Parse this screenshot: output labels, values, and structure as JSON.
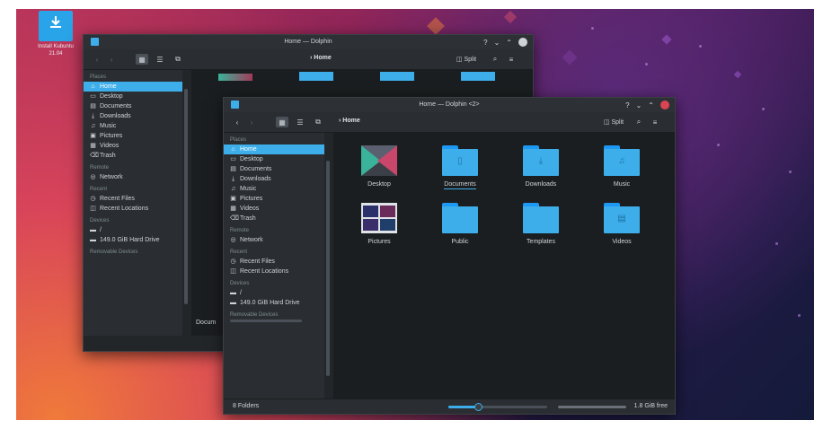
{
  "desktop": {
    "icon_label_top": "Install Kubuntu",
    "icon_label_bottom": "21.04",
    "icon_name": "download-icon"
  },
  "back_window": {
    "title": "Home — Dolphin",
    "breadcrumb": "Home",
    "split_label": "Split",
    "sections": {
      "places": "Places",
      "remote": "Remote",
      "recent": "Recent",
      "devices": "Devices",
      "removable": "Removable Devices"
    },
    "places": [
      "Home",
      "Desktop",
      "Documents",
      "Downloads",
      "Music",
      "Pictures",
      "Videos",
      "Trash"
    ],
    "remote": [
      "Network"
    ],
    "recent": [
      "Recent Files",
      "Recent Locations"
    ],
    "devices": [
      "/",
      "149.0 GiB Hard Drive"
    ],
    "partial_label": "Docum"
  },
  "front_window": {
    "title": "Home — Dolphin <2>",
    "breadcrumb": "Home",
    "split_label": "Split",
    "sections": {
      "places": "Places",
      "remote": "Remote",
      "recent": "Recent",
      "devices": "Devices",
      "removable": "Removable Devices"
    },
    "places": [
      "Home",
      "Desktop",
      "Documents",
      "Downloads",
      "Music",
      "Pictures",
      "Videos",
      "Trash"
    ],
    "remote": [
      "Network"
    ],
    "recent": [
      "Recent Files",
      "Recent Locations"
    ],
    "devices": [
      "/",
      "149.0 GiB Hard Drive"
    ],
    "items": [
      {
        "name": "Desktop",
        "kind": "thumb-desktop"
      },
      {
        "name": "Documents",
        "kind": "folder",
        "emblem": "document-icon"
      },
      {
        "name": "Downloads",
        "kind": "folder",
        "emblem": "download-icon"
      },
      {
        "name": "Music",
        "kind": "folder",
        "emblem": "music-icon"
      },
      {
        "name": "Pictures",
        "kind": "thumb-pictures"
      },
      {
        "name": "Public",
        "kind": "folder",
        "emblem": ""
      },
      {
        "name": "Templates",
        "kind": "folder",
        "emblem": ""
      },
      {
        "name": "Videos",
        "kind": "folder",
        "emblem": "video-icon"
      }
    ],
    "status": {
      "folders_count": "8 Folders",
      "free_space": "1.8 GiB free",
      "zoom_fraction": 0.3
    }
  },
  "colors": {
    "accent": "#3daee9",
    "close": "#da4453",
    "window_bg": "#232629",
    "content_bg": "#1b1e20"
  }
}
